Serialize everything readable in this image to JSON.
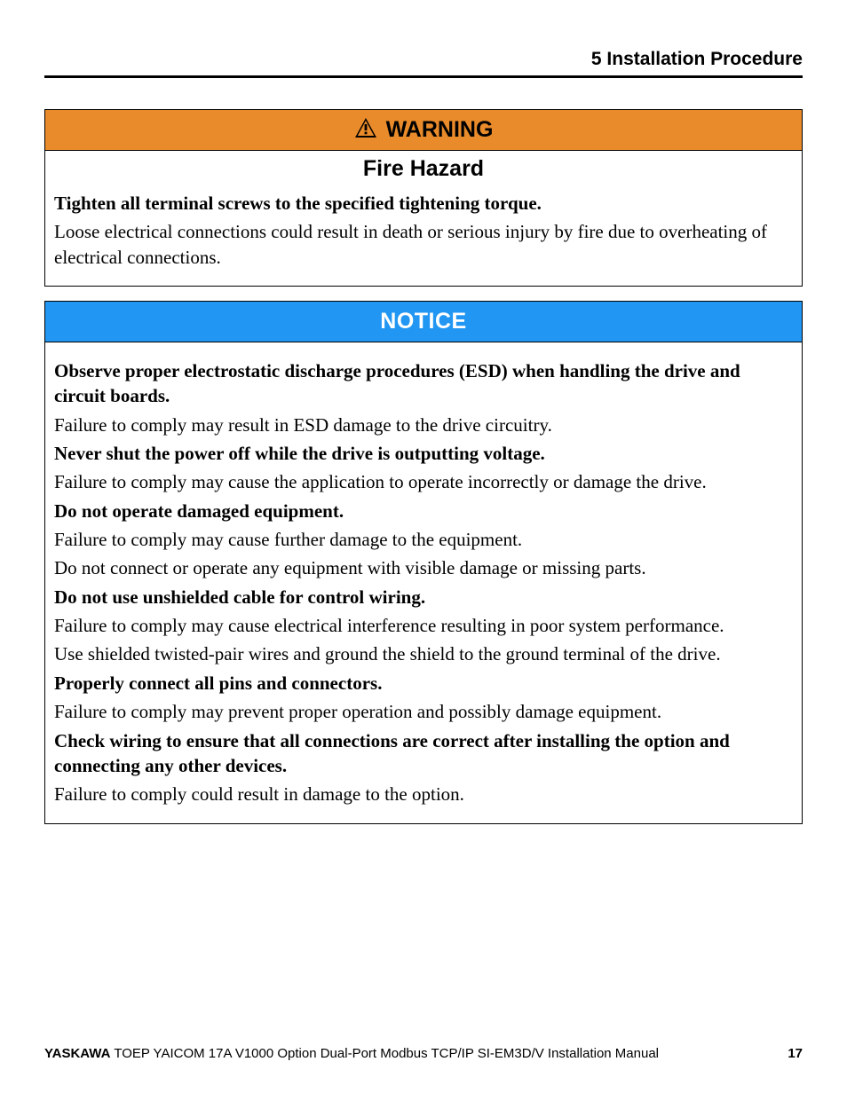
{
  "header": {
    "section": "5  Installation Procedure"
  },
  "warning": {
    "label": "WARNING",
    "subhead": "Fire Hazard",
    "p1": "Tighten all terminal screws to the specified tightening torque.",
    "p2": "Loose electrical connections could result in death or serious injury by fire due to overheating of electrical connections."
  },
  "notice": {
    "label": "NOTICE",
    "p1": "Observe proper electrostatic discharge procedures (ESD) when handling the drive and circuit boards.",
    "p2": "Failure to comply may result in ESD damage to the drive circuitry.",
    "p3": "Never shut the power off while the drive is outputting voltage.",
    "p4": "Failure to comply may cause the application to operate incorrectly or damage the drive.",
    "p5": "Do not operate damaged equipment.",
    "p6": "Failure to comply may cause further damage to the equipment.",
    "p7": "Do not connect or operate any equipment with visible damage or missing parts.",
    "p8": "Do not use unshielded cable for control wiring.",
    "p9": "Failure to comply may cause electrical interference resulting in poor system performance.",
    "p10": "Use shielded twisted-pair wires and ground the shield to the ground terminal of the drive.",
    "p11": "Properly connect all pins and connectors.",
    "p12": "Failure to comply may prevent proper operation and possibly damage equipment.",
    "p13": "Check wiring to ensure that all connections are correct after installing the option and connecting any other devices.",
    "p14": "Failure to comply could result in damage to the option."
  },
  "footer": {
    "brand": "YASKAWA",
    "title": " TOEP YAICOM 17A V1000 Option Dual-Port Modbus TCP/IP SI-EM3D/V Installation Manual",
    "page": "17"
  }
}
